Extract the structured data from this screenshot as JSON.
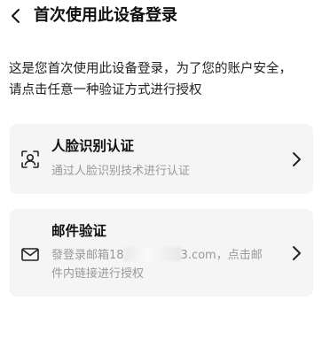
{
  "header": {
    "title": "首次使用此设备登录"
  },
  "intro": {
    "line1": "这是您首次使用此设备登录，为了您的账户安全，",
    "line2": "请点击任意一种验证方式进行授权"
  },
  "options": [
    {
      "title": "人脸识别认证",
      "desc": "通过人脸识别技术进行认证",
      "icon": "face-scan-icon"
    },
    {
      "title": "邮件验证",
      "desc_prefix": "發登录邮箱18",
      "desc_suffix": "3.com，点击邮",
      "desc_line2": "件内链接进行授权",
      "icon": "mail-icon"
    }
  ]
}
